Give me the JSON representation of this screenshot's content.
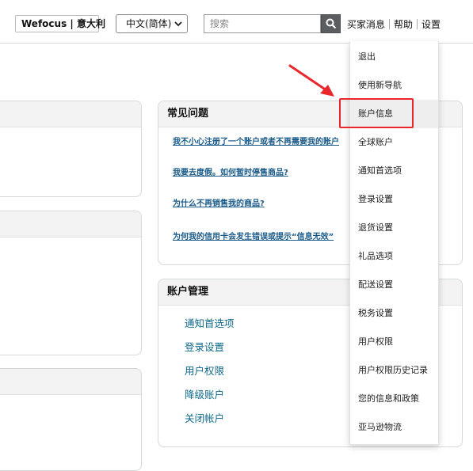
{
  "header": {
    "seller_name": "Wefocus | 意大利",
    "language": "中文(简体)",
    "search_placeholder": "搜索",
    "links": {
      "buyer_messages": "买家消息",
      "help": "帮助",
      "settings": "设置"
    }
  },
  "faq": {
    "title": "常见问题",
    "items": [
      "我不小心注册了一个账户或者不再需要我的账户",
      "我要去度假。如何暂时停售商品?",
      "为什么不再销售我的商品?",
      "为何我的信用卡会发生错误或提示“信息无效”"
    ]
  },
  "account_management": {
    "title": "账户管理",
    "items": [
      "通知首选项",
      "登录设置",
      "用户权限",
      "降级账户",
      "关闭帐户"
    ]
  },
  "settings_menu": {
    "items": [
      "退出",
      "使用新导航",
      "账户信息",
      "全球账户",
      "通知首选项",
      "登录设置",
      "退货设置",
      "礼品选项",
      "配送设置",
      "税务设置",
      "用户权限",
      "用户权限历史记录",
      "您的信息和政策",
      "亚马逊物流"
    ],
    "highlighted_index": 2
  },
  "colors": {
    "annotation_red": "#e8262b",
    "link_blue": "#0f6a8a"
  }
}
